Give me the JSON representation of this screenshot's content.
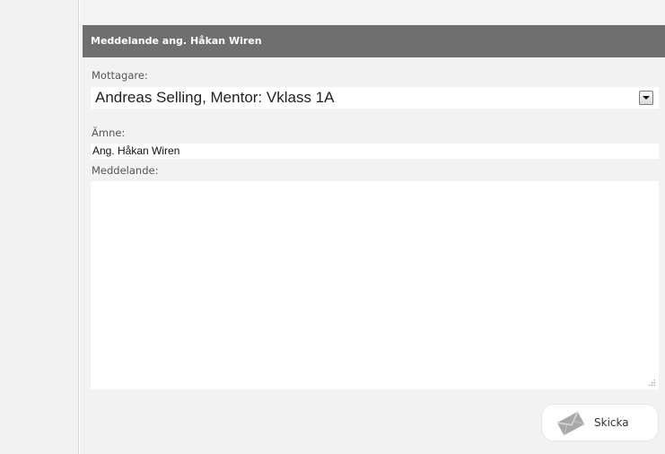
{
  "header": {
    "title": "Meddelande ang. Håkan Wiren"
  },
  "form": {
    "recipient_label": "Mottagare:",
    "recipient_value": "Andreas Selling, Mentor: Vklass 1A",
    "subject_label": "Ämne:",
    "subject_value": "Ang. Håkan Wiren",
    "message_label": "Meddelande:",
    "message_value": ""
  },
  "actions": {
    "send_label": "Skicka",
    "send_icon": "envelope-icon"
  },
  "colors": {
    "header_bg": "#6f6f6f",
    "panel_bg": "#f2f2f2"
  }
}
